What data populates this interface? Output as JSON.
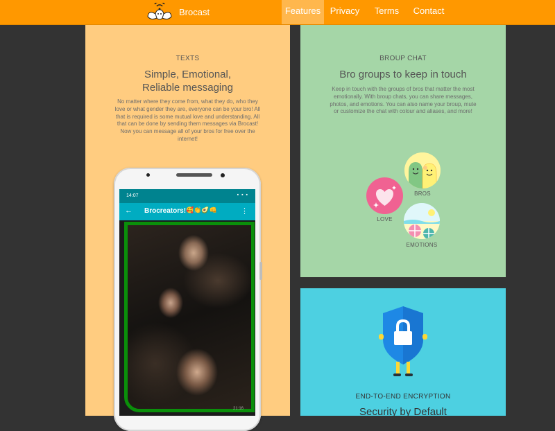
{
  "nav": {
    "brand": "Brocast",
    "items": [
      {
        "label": "Features",
        "active": true
      },
      {
        "label": "Privacy",
        "active": false
      },
      {
        "label": "Terms",
        "active": false
      },
      {
        "label": "Contact",
        "active": false
      }
    ]
  },
  "texts": {
    "eyebrow": "TEXTS",
    "headline_line1": "Simple, Emotional,",
    "headline_line2": "Reliable messaging",
    "body": "No matter where they come from, what they do, who they love or what gender they are, everyone can be your bro! All that is required is some mutual love and understanding. All that can be done by sending them messages via Brocast! Now you can message all of your bros for free over the internet!"
  },
  "phone": {
    "status_time": "14:07",
    "status_icons": "▪ ▪ ▪",
    "chat_title": "Brocreators!",
    "chat_emojis": "🥰👏🥑👊",
    "message_time": "21:16"
  },
  "group_chat": {
    "eyebrow": "BROUP CHAT",
    "headline": "Bro groups to keep in touch",
    "body": "Keep in touch with the groups of bros that matter the most emotionally. With broup chats, you can share messages, photos, and emotions. You can also name your broup, mute or customize the chat with colour and aliases, and more!",
    "labels": {
      "bros": "BROS",
      "love": "LOVE",
      "emotions": "EMOTIONS"
    }
  },
  "security": {
    "eyebrow": "END-TO-END ENCRYPTION",
    "headline": "Security by Default"
  },
  "colors": {
    "navbar": "#ff9800",
    "nav_active": "#ffb74d",
    "texts_panel": "#ffcc80",
    "group_panel": "#a5d6a7",
    "security_panel": "#4dd0e1",
    "background": "#333333"
  },
  "icons": [
    "logo-icon",
    "back-arrow-icon",
    "more-vert-icon",
    "heart-icon",
    "bros-faces-icon",
    "beach-umbrella-icon",
    "shield-lock-icon"
  ]
}
